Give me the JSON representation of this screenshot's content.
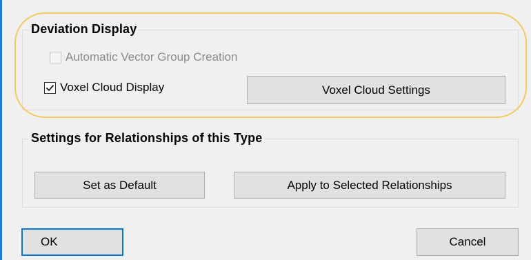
{
  "deviation_display": {
    "title": "Deviation Display",
    "auto_vector_group": {
      "label": "Automatic Vector Group Creation",
      "checked": false,
      "enabled": false
    },
    "voxel_cloud_display": {
      "label": "Voxel Cloud Display",
      "checked": true,
      "enabled": true
    },
    "voxel_cloud_settings_button": "Voxel Cloud Settings"
  },
  "relationship_settings": {
    "title": "Settings for Relationships of this Type",
    "set_default_button": "Set as Default",
    "apply_selected_button": "Apply to Selected Relationships"
  },
  "footer": {
    "ok_button": "OK",
    "cancel_button": "Cancel"
  },
  "colors": {
    "highlight_ring": "#f2cb5c",
    "default_button_border": "#0078d7",
    "dialog_background": "#f0f0f0"
  },
  "icons": {
    "checkmark": "checkmark-icon"
  }
}
